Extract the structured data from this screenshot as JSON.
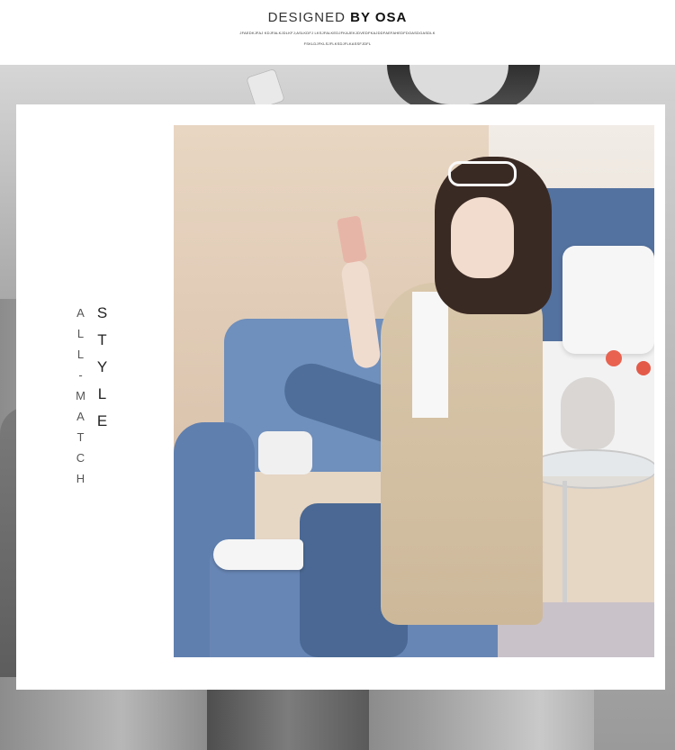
{
  "header": {
    "title_light": "DESIGNED",
    "title_bold": "BY OSA",
    "subtitle_line1": "JFAEDKJFAJ KDJFALKJDLKFJ;ASLKDFJ LKSJFALKEDJFKAJEKJDVEDFKAJDDFAEFAHEDFDOASDGASDLK",
    "subtitle_line2": "FSKLDJFKLSJFLKSDJFLKASSFJDFL"
  },
  "side_text": {
    "style": "STYLE",
    "all_match": "ALL-MATCH"
  }
}
